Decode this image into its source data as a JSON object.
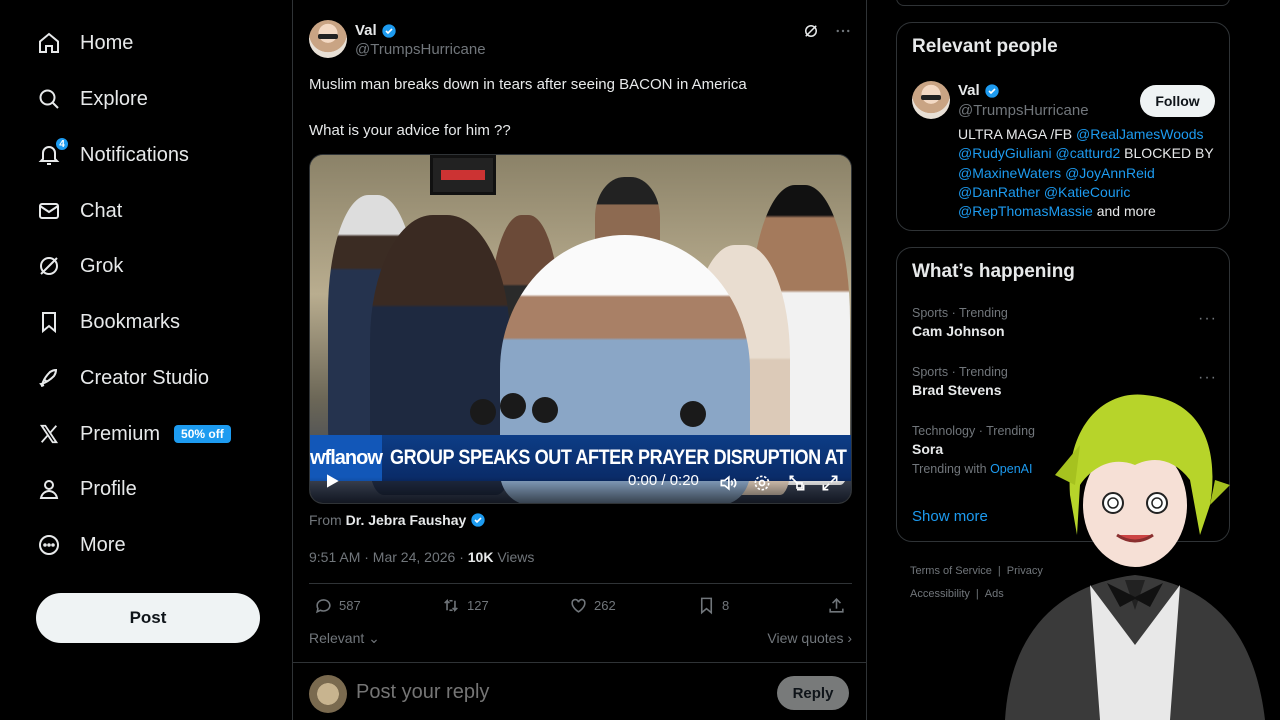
{
  "sidebar": {
    "items": [
      {
        "label": "Home",
        "icon": "home-icon"
      },
      {
        "label": "Explore",
        "icon": "search-icon"
      },
      {
        "label": "Notifications",
        "icon": "bell-icon",
        "badge": "4"
      },
      {
        "label": "Chat",
        "icon": "mail-icon"
      },
      {
        "label": "Grok",
        "icon": "grok-icon"
      },
      {
        "label": "Bookmarks",
        "icon": "bookmark-icon"
      },
      {
        "label": "Creator Studio",
        "icon": "rocket-icon"
      },
      {
        "label": "Premium",
        "icon": "x-logo-icon",
        "promo": "50% off"
      },
      {
        "label": "Profile",
        "icon": "person-icon"
      },
      {
        "label": "More",
        "icon": "more-circle-icon"
      }
    ],
    "post_label": "Post"
  },
  "tweet": {
    "author_name": "Val",
    "author_handle": "@TrumpsHurricane",
    "text_line1": "Muslim man breaks down in tears after seeing BACON in America",
    "text_line2": "What is your advice for him ??",
    "video": {
      "logo_text": "wflanow",
      "chyron": "GROUP SPEAKS OUT AFTER PRAYER DISRUPTION AT US",
      "time": "0:00 / 0:20"
    },
    "from_label": "From",
    "from_name": "Dr. Jebra Faushay",
    "time": "9:51 AM · Mar 24, 2026 · ",
    "views_count": "10K",
    "views_label": " Views",
    "replies": "587",
    "reposts": "127",
    "likes": "262",
    "bookmarks": "8",
    "sort_label": "Relevant",
    "view_quotes": "View quotes",
    "reply_placeholder": "Post your reply",
    "reply_button": "Reply"
  },
  "relevant_people": {
    "title": "Relevant people",
    "name": "Val",
    "handle": "@TrumpsHurricane",
    "follow_label": "Follow",
    "bio_parts": {
      "p1": "ULTRA MAGA /FB ",
      "m1": "@RealJamesWoods",
      "m2": "@RudyGiuliani",
      "m3": "@catturd2",
      "p2": " BLOCKED BY ",
      "m4": "@MaxineWaters",
      "m5": "@JoyAnnReid",
      "m6": "@DanRather",
      "m7": "@KatieCouric",
      "m8": "@RepThomasMassie",
      "p3": " and more"
    }
  },
  "trends": {
    "title": "What’s happening",
    "items": [
      {
        "category": "Sports · Trending",
        "name": "Cam Johnson"
      },
      {
        "category": "Sports · Trending",
        "name": "Brad Stevens"
      },
      {
        "category": "Technology · Trending",
        "name": "Sora",
        "with_label": "Trending with",
        "with_link": "OpenAI"
      }
    ],
    "show_more": "Show more"
  },
  "footer": {
    "links": [
      "Terms of Service",
      "|",
      "Privacy",
      "Accessibility",
      "|",
      "Ads"
    ]
  },
  "colors": {
    "accent": "#1d9bf0",
    "background": "#000000",
    "border": "#2f3336"
  }
}
